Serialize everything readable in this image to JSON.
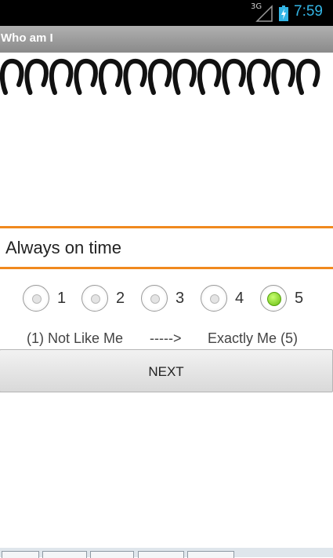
{
  "status_bar": {
    "network": "3G",
    "time": "7:59"
  },
  "title_bar": {
    "title": "Who am I"
  },
  "statement": {
    "text": "Always on time"
  },
  "rating": {
    "options": [
      "1",
      "2",
      "3",
      "4",
      "5"
    ],
    "selected": "5"
  },
  "scale": {
    "low_label": "(1) Not Like Me",
    "arrow": "----->",
    "high_label": "Exactly Me (5)"
  },
  "actions": {
    "next_label": "NEXT"
  },
  "colors": {
    "accent": "#f0891e",
    "time": "#33b5e5",
    "selected": "#66bb10"
  }
}
